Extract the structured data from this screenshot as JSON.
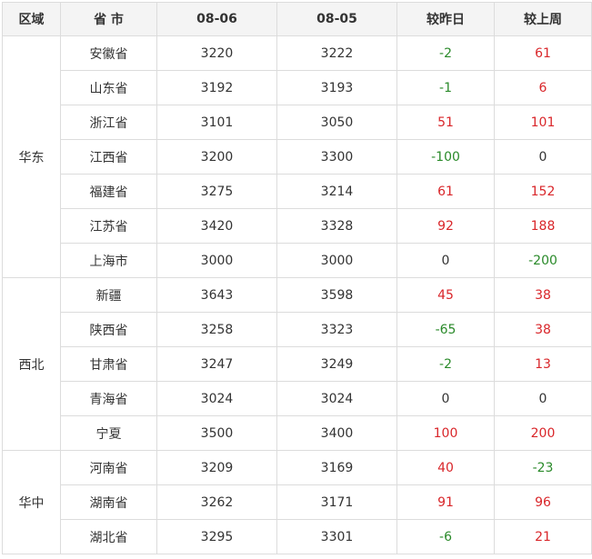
{
  "colors": {
    "up": "#d9262a",
    "down": "#2a8a2a",
    "flat": "#333333"
  },
  "table": {
    "headers": [
      "区域",
      "省 市",
      "08-06",
      "08-05",
      "较昨日",
      "较上周"
    ],
    "regions": [
      {
        "name": "华东",
        "rows": [
          {
            "province": "安徽省",
            "d1": "3220",
            "d2": "3222",
            "dd": "-2",
            "dw": "61"
          },
          {
            "province": "山东省",
            "d1": "3192",
            "d2": "3193",
            "dd": "-1",
            "dw": "6"
          },
          {
            "province": "浙江省",
            "d1": "3101",
            "d2": "3050",
            "dd": "51",
            "dw": "101"
          },
          {
            "province": "江西省",
            "d1": "3200",
            "d2": "3300",
            "dd": "-100",
            "dw": "0"
          },
          {
            "province": "福建省",
            "d1": "3275",
            "d2": "3214",
            "dd": "61",
            "dw": "152"
          },
          {
            "province": "江苏省",
            "d1": "3420",
            "d2": "3328",
            "dd": "92",
            "dw": "188"
          },
          {
            "province": "上海市",
            "d1": "3000",
            "d2": "3000",
            "dd": "0",
            "dw": "-200"
          }
        ]
      },
      {
        "name": "西北",
        "rows": [
          {
            "province": "新疆",
            "d1": "3643",
            "d2": "3598",
            "dd": "45",
            "dw": "38"
          },
          {
            "province": "陕西省",
            "d1": "3258",
            "d2": "3323",
            "dd": "-65",
            "dw": "38"
          },
          {
            "province": "甘肃省",
            "d1": "3247",
            "d2": "3249",
            "dd": "-2",
            "dw": "13"
          },
          {
            "province": "青海省",
            "d1": "3024",
            "d2": "3024",
            "dd": "0",
            "dw": "0"
          },
          {
            "province": "宁夏",
            "d1": "3500",
            "d2": "3400",
            "dd": "100",
            "dw": "200"
          }
        ]
      },
      {
        "name": "华中",
        "rows": [
          {
            "province": "河南省",
            "d1": "3209",
            "d2": "3169",
            "dd": "40",
            "dw": "-23"
          },
          {
            "province": "湖南省",
            "d1": "3262",
            "d2": "3171",
            "dd": "91",
            "dw": "96"
          },
          {
            "province": "湖北省",
            "d1": "3295",
            "d2": "3301",
            "dd": "-6",
            "dw": "21"
          }
        ]
      }
    ]
  }
}
